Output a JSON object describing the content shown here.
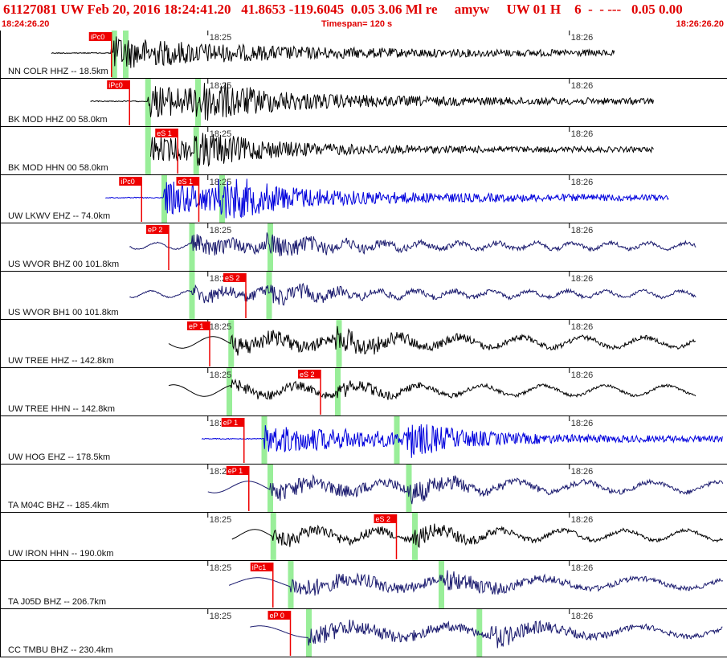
{
  "header": {
    "title": "61127081 UW Feb 20, 2016 18:24:41.20   41.8653 -119.6045  0.05 3.06 Ml re     amyw     UW 01 H    6  -  - ---   0.05 0.00",
    "start_time": "18:24:26.20",
    "timespan": "Timespan= 120 s",
    "end_time": "18:26:26.20"
  },
  "chart_data": {
    "type": "line",
    "time_ticks": [
      {
        "label": "18:25",
        "t": 34.5
      },
      {
        "label": "18:26",
        "t": 94.5
      }
    ],
    "timespan_s": 120,
    "colors": {
      "pick_box": "#ee0000",
      "pick_text": "#ffffff",
      "marker": "#99ee99",
      "black": "#000000",
      "blue": "#0000dd",
      "navy": "#1a1a6e"
    },
    "traces": [
      {
        "label": "NN COLR HHZ -- 18.5km",
        "color": "black",
        "t0": 8.5,
        "t1": 102,
        "picks": [
          {
            "label": "iPc0",
            "t": 18.5
          }
        ],
        "markers": [
          18.9,
          20.8
        ],
        "arrival": 18.5,
        "amp": 1.0,
        "period": 0.35,
        "style": "hf"
      },
      {
        "label": "BK MOD HHZ 00 58.0km",
        "color": "black",
        "t0": 15,
        "t1": 108.5,
        "picks": [
          {
            "label": "iPc0",
            "t": 21.5
          }
        ],
        "markers": [
          24.5,
          32.8
        ],
        "arrival": 24.5,
        "s_arrival": 32.8,
        "amp": 1.0,
        "period": 0.35,
        "style": "hf"
      },
      {
        "label": "BK MOD HHN 00 58.0km",
        "color": "black",
        "t0": 25,
        "t1": 108.5,
        "picks": [
          {
            "label": "eS 1",
            "t": 29.5
          }
        ],
        "markers": [
          24.5,
          32.5
        ],
        "arrival": 24.5,
        "s_arrival": 32.8,
        "amp": 0.8,
        "period": 0.35,
        "style": "hf"
      },
      {
        "label": "UW LKWV EHZ -- 74.0km",
        "color": "blue",
        "t0": 17.5,
        "t1": 111,
        "picks": [
          {
            "label": "iPc0",
            "t": 23.5
          },
          {
            "label": "eS 1",
            "t": 33
          }
        ],
        "markers": [
          27.2,
          36.8
        ],
        "arrival": 27.2,
        "s_arrival": 36.8,
        "amp": 1.0,
        "period": 0.3,
        "style": "hf"
      },
      {
        "label": "US WVOR BHZ 00 101.8km",
        "color": "navy",
        "t0": 21.5,
        "t1": 115.5,
        "picks": [
          {
            "label": "eP 2",
            "t": 28
          }
        ],
        "markers": [
          31.8,
          44.8
        ],
        "arrival": 31.8,
        "s_arrival": 44.8,
        "amp": 0.75,
        "period": 0.9,
        "style": "mid"
      },
      {
        "label": "US WVOR BH1 00 101.8km",
        "color": "navy",
        "t0": 21.5,
        "t1": 115.5,
        "picks": [
          {
            "label": "eS 2",
            "t": 40.8
          }
        ],
        "markers": [
          31.8,
          44.6
        ],
        "arrival": 31.8,
        "s_arrival": 44.8,
        "amp": 0.65,
        "period": 0.9,
        "style": "mid"
      },
      {
        "label": "UW TREE HHZ -- 142.8km",
        "color": "black",
        "t0": 28,
        "t1": 115.5,
        "picks": [
          {
            "label": "eP 1",
            "t": 34.8
          }
        ],
        "markers": [
          38.3,
          56.2
        ],
        "arrival": 38.3,
        "s_arrival": 56.2,
        "amp": 0.9,
        "period": 1.1,
        "style": "low"
      },
      {
        "label": "UW TREE HHN -- 142.8km",
        "color": "black",
        "t0": 28,
        "t1": 115.5,
        "picks": [
          {
            "label": "eS 2",
            "t": 53.2
          }
        ],
        "markers": [
          38.0,
          56.0
        ],
        "arrival": 38.3,
        "s_arrival": 56.2,
        "amp": 0.55,
        "period": 1.1,
        "style": "low"
      },
      {
        "label": "UW HOG EHZ -- 178.5km",
        "color": "blue",
        "t0": 33.5,
        "t1": 120,
        "picks": [
          {
            "label": "eP 1",
            "t": 40.5
          }
        ],
        "markers": [
          43.8,
          65.8
        ],
        "arrival": 43.8,
        "s_arrival": 68.0,
        "amp": 0.9,
        "period": 0.3,
        "style": "hf"
      },
      {
        "label": "TA M04C BHZ -- 185.4km",
        "color": "navy",
        "t0": 34.5,
        "t1": 120,
        "picks": [
          {
            "label": "eP 1",
            "t": 41.3
          }
        ],
        "markers": [
          44.8,
          67.8
        ],
        "arrival": 44.8,
        "s_arrival": 68.0,
        "amp": 0.9,
        "period": 1.2,
        "style": "low"
      },
      {
        "label": "UW IRON HHN -- 190.0km",
        "color": "black",
        "t0": 38.5,
        "t1": 120,
        "picks": [
          {
            "label": "eS 2",
            "t": 65.8
          }
        ],
        "markers": [
          45.3,
          68.8
        ],
        "arrival": 45.3,
        "s_arrival": 69.0,
        "amp": 0.7,
        "period": 1.1,
        "style": "low"
      },
      {
        "label": "TA J05D BHZ -- 206.7km",
        "color": "navy",
        "t0": 38,
        "t1": 120,
        "picks": [
          {
            "label": "iPc1",
            "t": 45.3
          }
        ],
        "markers": [
          48.2,
          73.2
        ],
        "arrival": 48.2,
        "s_arrival": 74.0,
        "amp": 0.9,
        "period": 1.7,
        "style": "low"
      },
      {
        "label": "CC TMBU BHZ -- 230.4km",
        "color": "navy",
        "t0": 41.5,
        "t1": 120,
        "picks": [
          {
            "label": "eP 0",
            "t": 48.2
          }
        ],
        "markers": [
          51.2,
          79.5
        ],
        "arrival": 51.2,
        "s_arrival": 82.0,
        "amp": 0.9,
        "period": 1.7,
        "style": "low"
      }
    ]
  }
}
